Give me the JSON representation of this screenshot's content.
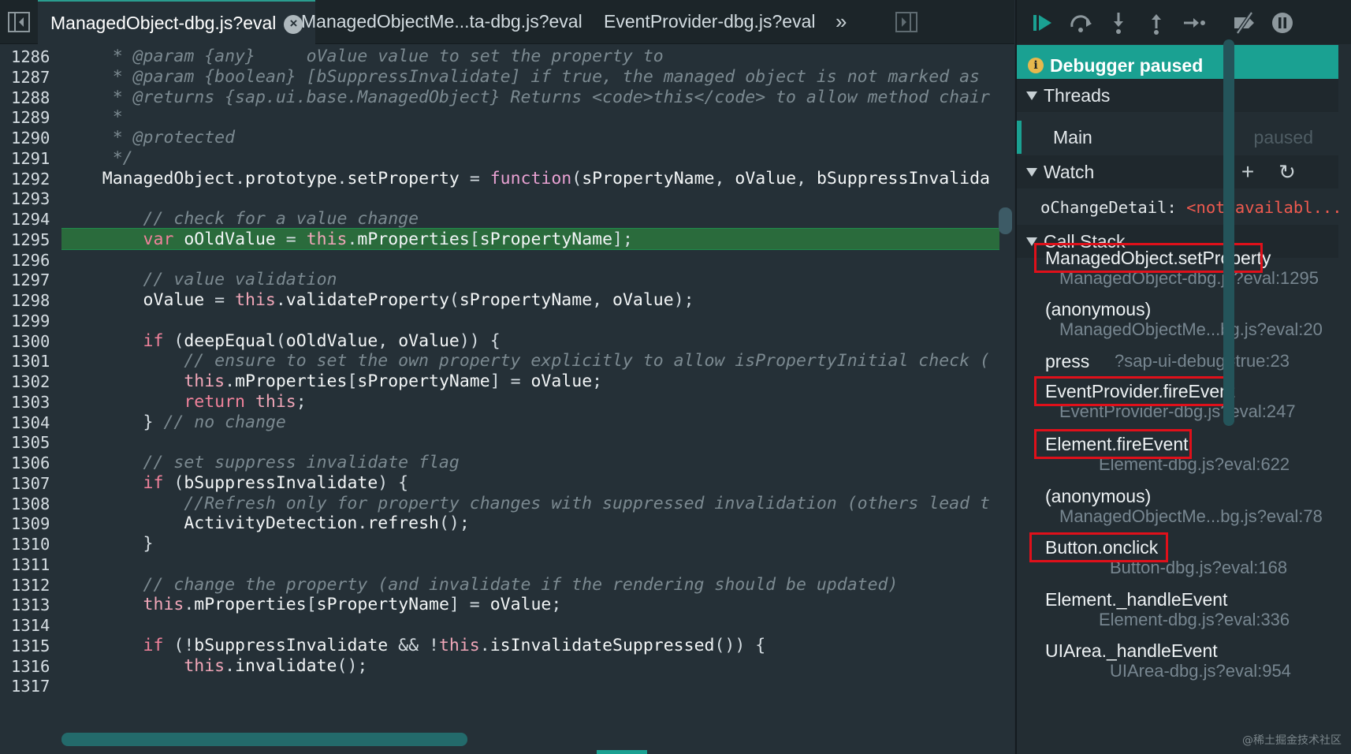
{
  "editor": {
    "tabs": [
      {
        "label": "ManagedObject-dbg.js?eval",
        "active": true,
        "closable": true
      },
      {
        "label": "ManagedObjectMe...ta-dbg.js?eval",
        "active": false
      },
      {
        "label": "EventProvider-dbg.js?eval",
        "active": false
      }
    ],
    "overflow_glyph": "»",
    "highlight_line": 1295,
    "lines": [
      {
        "n": "1286",
        "segs": [
          [
            "com",
            "     * @param {any}     oValue value to set the property to"
          ]
        ]
      },
      {
        "n": "1287",
        "segs": [
          [
            "com",
            "     * @param {boolean} [bSuppressInvalidate] if true, the managed object is not marked as"
          ]
        ]
      },
      {
        "n": "1288",
        "segs": [
          [
            "com",
            "     * @returns {sap.ui.base.ManagedObject} Returns <code>this</code> to allow method chair"
          ]
        ]
      },
      {
        "n": "1289",
        "segs": [
          [
            "com",
            "     *"
          ]
        ]
      },
      {
        "n": "1290",
        "segs": [
          [
            "com",
            "     * @protected"
          ]
        ]
      },
      {
        "n": "1291",
        "segs": [
          [
            "com",
            "     */"
          ]
        ]
      },
      {
        "n": "1292",
        "segs": [
          [
            "id",
            "    ManagedObject"
          ],
          [
            "br",
            "."
          ],
          [
            "id",
            "prototype"
          ],
          [
            "br",
            "."
          ],
          [
            "id",
            "setProperty "
          ],
          [
            "br",
            "= "
          ],
          [
            "fn",
            "function"
          ],
          [
            "br",
            "("
          ],
          [
            "id",
            "sPropertyName"
          ],
          [
            "br",
            ", "
          ],
          [
            "id",
            "oValue"
          ],
          [
            "br",
            ", "
          ],
          [
            "id",
            "bSuppressInvalida"
          ]
        ]
      },
      {
        "n": "1293",
        "segs": [
          [
            "id",
            ""
          ]
        ]
      },
      {
        "n": "1294",
        "segs": [
          [
            "com",
            "        // check for a value change"
          ]
        ]
      },
      {
        "n": "1295",
        "segs": [
          [
            "kw",
            "        var "
          ],
          [
            "id",
            "oOldValue "
          ],
          [
            "br",
            "= "
          ],
          [
            "this",
            "this"
          ],
          [
            "br",
            "."
          ],
          [
            "id",
            "mProperties"
          ],
          [
            "br",
            "["
          ],
          [
            "id",
            "sPropertyName"
          ],
          [
            "br",
            "];"
          ]
        ]
      },
      {
        "n": "1296",
        "segs": [
          [
            "id",
            ""
          ]
        ]
      },
      {
        "n": "1297",
        "segs": [
          [
            "com",
            "        // value validation"
          ]
        ]
      },
      {
        "n": "1298",
        "segs": [
          [
            "id",
            "        oValue "
          ],
          [
            "br",
            "= "
          ],
          [
            "this",
            "this"
          ],
          [
            "br",
            "."
          ],
          [
            "id",
            "validateProperty"
          ],
          [
            "br",
            "("
          ],
          [
            "id",
            "sPropertyName"
          ],
          [
            "br",
            ", "
          ],
          [
            "id",
            "oValue"
          ],
          [
            "br",
            ");"
          ]
        ]
      },
      {
        "n": "1299",
        "segs": [
          [
            "id",
            ""
          ]
        ]
      },
      {
        "n": "1300",
        "segs": [
          [
            "kw",
            "        if "
          ],
          [
            "br",
            "("
          ],
          [
            "id",
            "deepEqual"
          ],
          [
            "br",
            "("
          ],
          [
            "id",
            "oOldValue"
          ],
          [
            "br",
            ", "
          ],
          [
            "id",
            "oValue"
          ],
          [
            "br",
            ")) {"
          ]
        ]
      },
      {
        "n": "1301",
        "segs": [
          [
            "com",
            "            // ensure to set the own property explicitly to allow isPropertyInitial check ("
          ]
        ]
      },
      {
        "n": "1302",
        "segs": [
          [
            "this",
            "            this"
          ],
          [
            "br",
            "."
          ],
          [
            "id",
            "mProperties"
          ],
          [
            "br",
            "["
          ],
          [
            "id",
            "sPropertyName"
          ],
          [
            "br",
            "] = "
          ],
          [
            "id",
            "oValue"
          ],
          [
            "br",
            ";"
          ]
        ]
      },
      {
        "n": "1303",
        "segs": [
          [
            "kw",
            "            return "
          ],
          [
            "this",
            "this"
          ],
          [
            "br",
            ";"
          ]
        ]
      },
      {
        "n": "1304",
        "segs": [
          [
            "br",
            "        } "
          ],
          [
            "com",
            "// no change"
          ]
        ]
      },
      {
        "n": "1305",
        "segs": [
          [
            "id",
            ""
          ]
        ]
      },
      {
        "n": "1306",
        "segs": [
          [
            "com",
            "        // set suppress invalidate flag"
          ]
        ]
      },
      {
        "n": "1307",
        "segs": [
          [
            "kw",
            "        if "
          ],
          [
            "br",
            "("
          ],
          [
            "id",
            "bSuppressInvalidate"
          ],
          [
            "br",
            ") {"
          ]
        ]
      },
      {
        "n": "1308",
        "segs": [
          [
            "com",
            "            //Refresh only for property changes with suppressed invalidation (others lead t"
          ]
        ]
      },
      {
        "n": "1309",
        "segs": [
          [
            "id",
            "            ActivityDetection"
          ],
          [
            "br",
            "."
          ],
          [
            "id",
            "refresh"
          ],
          [
            "br",
            "();"
          ]
        ]
      },
      {
        "n": "1310",
        "segs": [
          [
            "br",
            "        }"
          ]
        ]
      },
      {
        "n": "1311",
        "segs": [
          [
            "id",
            ""
          ]
        ]
      },
      {
        "n": "1312",
        "segs": [
          [
            "com",
            "        // change the property (and invalidate if the rendering should be updated)"
          ]
        ]
      },
      {
        "n": "1313",
        "segs": [
          [
            "this",
            "        this"
          ],
          [
            "br",
            "."
          ],
          [
            "id",
            "mProperties"
          ],
          [
            "br",
            "["
          ],
          [
            "id",
            "sPropertyName"
          ],
          [
            "br",
            "] = "
          ],
          [
            "id",
            "oValue"
          ],
          [
            "br",
            ";"
          ]
        ]
      },
      {
        "n": "1314",
        "segs": [
          [
            "id",
            ""
          ]
        ]
      },
      {
        "n": "1315",
        "segs": [
          [
            "kw",
            "        if "
          ],
          [
            "br",
            "(!"
          ],
          [
            "id",
            "bSuppressInvalidate "
          ],
          [
            "br",
            "&& !"
          ],
          [
            "this",
            "this"
          ],
          [
            "br",
            "."
          ],
          [
            "id",
            "isInvalidateSuppressed"
          ],
          [
            "br",
            "()) {"
          ]
        ]
      },
      {
        "n": "1316",
        "segs": [
          [
            "this",
            "            this"
          ],
          [
            "br",
            "."
          ],
          [
            "id",
            "invalidate"
          ],
          [
            "br",
            "();"
          ]
        ]
      },
      {
        "n": "1317",
        "segs": [
          [
            "id",
            ""
          ]
        ]
      }
    ]
  },
  "debugger": {
    "status": "Debugger paused",
    "sections": {
      "threads": "Threads",
      "watch": "Watch",
      "callstack": "Call Stack"
    },
    "threads": [
      {
        "name": "Main",
        "state": "paused"
      }
    ],
    "watch": [
      {
        "name": "oChangeDetail",
        "sep": ":",
        "value": "<not availabl..."
      }
    ],
    "callstack": [
      {
        "name": "ManagedObject.setProperty",
        "location": "ManagedObject-dbg.js?eval:1295",
        "boxed": true
      },
      {
        "name": "(anonymous)",
        "location": "ManagedObjectMe...bg.js?eval:20",
        "boxed": false
      },
      {
        "name": "press",
        "location": "?sap-ui-debug=true:23",
        "boxed": false,
        "inline": true
      },
      {
        "name": "EventProvider.fireEvent",
        "location": "EventProvider-dbg.js?eval:247",
        "boxed": true
      },
      {
        "name": "Element.fireEvent",
        "location": "Element-dbg.js?eval:622",
        "boxed": true
      },
      {
        "name": "(anonymous)",
        "location": "ManagedObjectMe...bg.js?eval:78",
        "boxed": false
      },
      {
        "name": "Button.onclick",
        "location": "Button-dbg.js?eval:168",
        "boxed": true
      },
      {
        "name": "Element._handleEvent",
        "location": "Element-dbg.js?eval:336",
        "boxed": false
      },
      {
        "name": "UIArea._handleEvent",
        "location": "UIArea-dbg.js?eval:954",
        "boxed": false
      }
    ],
    "watermark": "@稀土掘金技术社区"
  },
  "colors": {
    "accent": "#1aa192",
    "highlight_line_bg": "#2a6b3c",
    "highlight_box": "#e0101a",
    "watch_value": "#ef5a4f"
  }
}
